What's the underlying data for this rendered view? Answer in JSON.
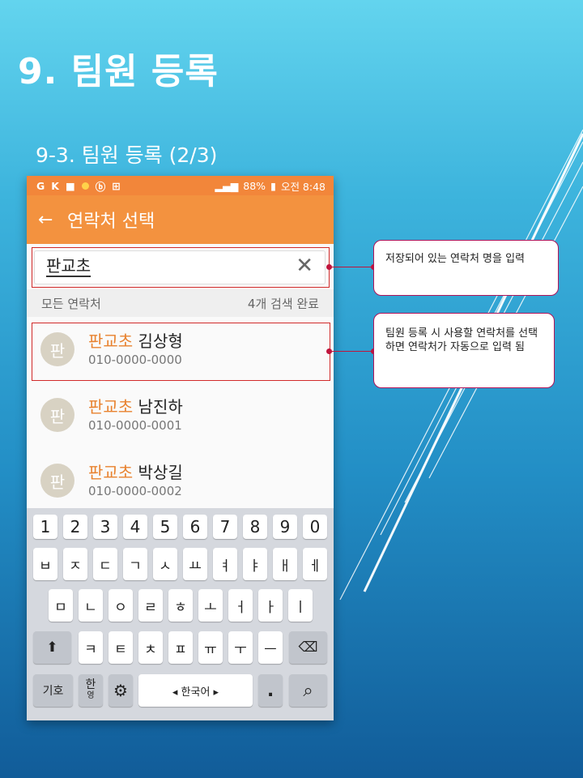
{
  "slide": {
    "title": "9. 팀원 등록",
    "subtitle": "9-3. 팀원 등록 (2/3)"
  },
  "status_bar": {
    "left_icons": [
      "G",
      "K",
      "■",
      "●",
      "ⓑ",
      "⊞"
    ],
    "battery": "88%",
    "time": "오전 8:48"
  },
  "app_bar": {
    "back_icon": "←",
    "title": "연락처 선택"
  },
  "search": {
    "value": "판교초",
    "clear_icon": "✕"
  },
  "list_header": {
    "left": "모든 연락처",
    "right": "4개 검색 완료"
  },
  "contacts": [
    {
      "avatar": "판",
      "highlight": "판교초",
      "name": " 김상형",
      "phone": "010-0000-0000"
    },
    {
      "avatar": "판",
      "highlight": "판교초",
      "name": " 남진하",
      "phone": "010-0000-0001"
    },
    {
      "avatar": "판",
      "highlight": "판교초",
      "name": " 박상길",
      "phone": "010-0000-0002"
    }
  ],
  "keyboard": {
    "row1": [
      "1",
      "2",
      "3",
      "4",
      "5",
      "6",
      "7",
      "8",
      "9",
      "0"
    ],
    "row2": [
      "ㅂ",
      "ㅈ",
      "ㄷ",
      "ㄱ",
      "ㅅ",
      "ㅛ",
      "ㅕ",
      "ㅑ",
      "ㅐ",
      "ㅔ"
    ],
    "row3": [
      "ㅁ",
      "ㄴ",
      "ㅇ",
      "ㄹ",
      "ㅎ",
      "ㅗ",
      "ㅓ",
      "ㅏ",
      "ㅣ"
    ],
    "row4": [
      "ㅋ",
      "ㅌ",
      "ㅊ",
      "ㅍ",
      "ㅠ",
      "ㅜ",
      "ㅡ"
    ],
    "shift_icon": "⬆",
    "backspace_icon": "⌫",
    "symbol_key": "기호",
    "lang_key_top": "한",
    "lang_key_bottom": "영",
    "settings_icon": "⚙",
    "space_label": "◂ 한국어 ▸",
    "period": ".",
    "search_icon": "⌕"
  },
  "callouts": {
    "first": "저장되어 있는 연락처 명을 입력",
    "second": "팀원 등록 시 사용할 연락처를 선택하면 연락처가 자동으로 입력 됨"
  }
}
